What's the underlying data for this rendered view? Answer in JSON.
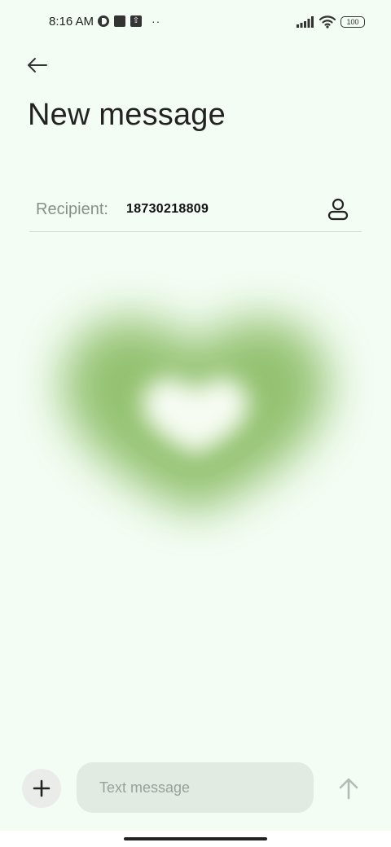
{
  "status_bar": {
    "time": "8:16 AM",
    "left_icons": [
      "vpn-icon",
      "square-app-icon",
      "upload-icon"
    ],
    "overflow_dots": "··",
    "battery": "100",
    "right_icons": [
      "signal-icon",
      "wifi-icon",
      "battery-icon"
    ]
  },
  "header": {
    "back_icon": "arrow-left-icon",
    "title": "New message"
  },
  "recipient": {
    "label": "Recipient:",
    "value": "18730218809",
    "contact_icon": "person-icon"
  },
  "composer": {
    "add_icon": "plus-icon",
    "placeholder": "Text message",
    "value": "",
    "send_icon": "arrow-up-icon"
  },
  "colors": {
    "background": "#f3fdf3",
    "heart": "#8fbf6a",
    "input_bg": "#e2ebe2",
    "add_bg": "#e9ece9"
  }
}
